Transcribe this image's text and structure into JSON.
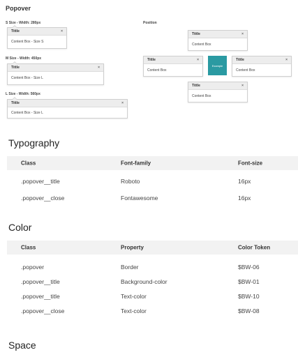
{
  "popover_section": {
    "title": "Popover",
    "size_s_label": "S Size - Width: 280px",
    "size_m_label": "M Size - Width: 450px",
    "size_l_label": "L Size - Width: 560px",
    "position_label": "Position",
    "popover_title": "Tittle",
    "close_glyph": "×",
    "content_s": "Content Box - Size S",
    "content_m": "Content Box - Size L",
    "content_l": "Content Box - Size L",
    "content_position": "Content Box",
    "target_label": "Example",
    "target_color": "#2a9aa2"
  },
  "typography": {
    "title": "Typography",
    "headers": [
      "Class",
      "Font-family",
      "Font-size"
    ],
    "rows": [
      [
        ".popover__title",
        "Roboto",
        "16px"
      ],
      [
        ".popover__close",
        "Fontawesome",
        "16px"
      ]
    ]
  },
  "color": {
    "title": "Color",
    "headers": [
      "Class",
      "Property",
      "Color Token"
    ],
    "rows": [
      [
        ".popover",
        "Border",
        "$BW-06"
      ],
      [
        ".popover__title",
        "Background-color",
        "$BW-01"
      ],
      [
        ".popover__title",
        "Text-color",
        "$BW-10"
      ],
      [
        ".popover__close",
        "Text-color",
        "$BW-08"
      ]
    ]
  },
  "space": {
    "title": "Space"
  }
}
